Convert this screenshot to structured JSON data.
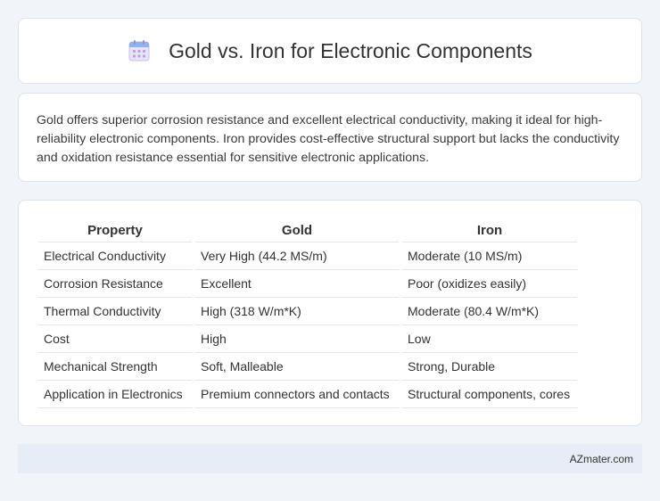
{
  "header": {
    "icon": "calendar-icon",
    "title": "Gold vs. Iron for Electronic Components"
  },
  "intro": {
    "text": "Gold offers superior corrosion resistance and excellent electrical conductivity, making it ideal for high-reliability electronic components. Iron provides cost-effective structural support but lacks the conductivity and oxidation resistance essential for sensitive electronic applications."
  },
  "table": {
    "headers": [
      "Property",
      "Gold",
      "Iron"
    ],
    "rows": [
      [
        "Electrical Conductivity",
        "Very High (44.2 MS/m)",
        "Moderate (10 MS/m)"
      ],
      [
        "Corrosion Resistance",
        "Excellent",
        "Poor (oxidizes easily)"
      ],
      [
        "Thermal Conductivity",
        "High (318 W/m*K)",
        "Moderate (80.4 W/m*K)"
      ],
      [
        "Cost",
        "High",
        "Low"
      ],
      [
        "Mechanical Strength",
        "Soft, Malleable",
        "Strong, Durable"
      ],
      [
        "Application in Electronics",
        "Premium connectors and contacts",
        "Structural components, cores"
      ]
    ]
  },
  "footer": {
    "site": "AZmater.com"
  }
}
